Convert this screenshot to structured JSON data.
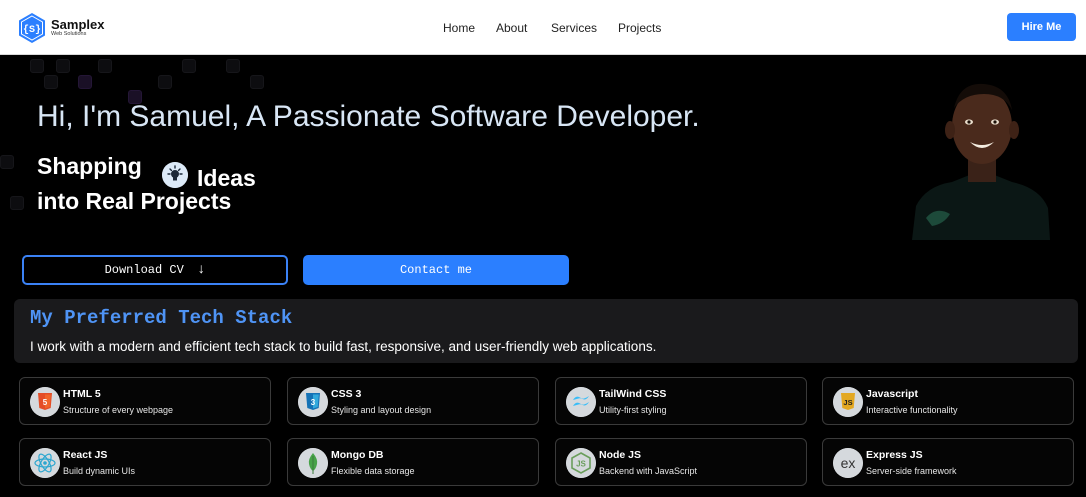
{
  "brand": {
    "name": "Samplex",
    "sub": "Web Solutions",
    "logo_glyph": "{S}",
    "accent": "#2b7fff"
  },
  "nav": {
    "items": [
      {
        "label": "Home"
      },
      {
        "label": "About"
      },
      {
        "label": "Services"
      },
      {
        "label": "Projects"
      }
    ],
    "cta": "Hire Me"
  },
  "hero": {
    "title": "Hi, I'm Samuel, A Passionate Software Developer.",
    "tagline_line1": "Shapping",
    "tagline_ideas": "Ideas",
    "tagline_line2": "into Real Projects",
    "download_label": "Download CV",
    "download_arrow": "↓",
    "contact_label": "Contact me"
  },
  "stack": {
    "title": "My Preferred Tech Stack",
    "description": "I work with a modern and efficient tech stack to build fast, responsive, and user-friendly web applications.",
    "items": [
      {
        "name": "HTML 5",
        "desc": "Structure of every webpage",
        "icon": "html5-icon"
      },
      {
        "name": "CSS 3",
        "desc": "Styling and layout design",
        "icon": "css3-icon"
      },
      {
        "name": "TailWind CSS",
        "desc": "Utility-first styling",
        "icon": "tailwind-icon"
      },
      {
        "name": "Javascript",
        "desc": "Interactive functionality",
        "icon": "javascript-icon"
      },
      {
        "name": "React JS",
        "desc": "Build dynamic UIs",
        "icon": "react-icon"
      },
      {
        "name": "Mongo DB",
        "desc": "Flexible data storage",
        "icon": "mongodb-icon"
      },
      {
        "name": "Node JS",
        "desc": "Backend with JavaScript",
        "icon": "nodejs-icon"
      },
      {
        "name": "Express JS",
        "desc": "Server-side framework",
        "icon": "express-icon"
      }
    ]
  }
}
